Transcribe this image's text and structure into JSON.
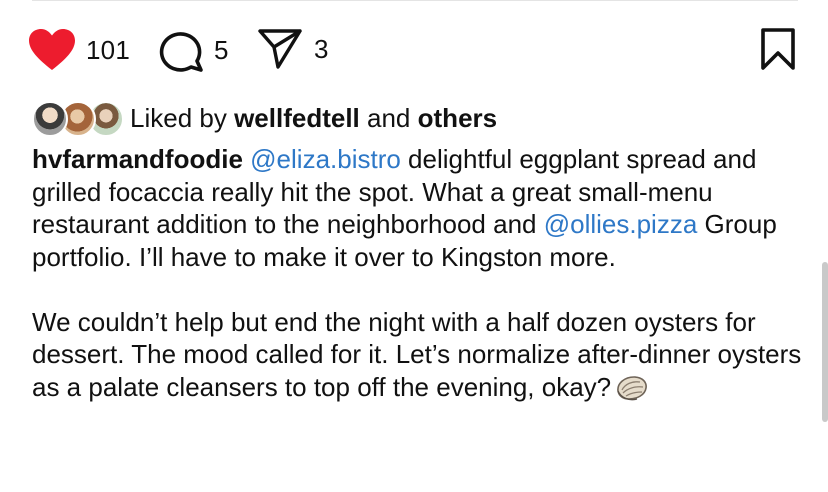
{
  "post": {
    "actions": {
      "likes_count": "101",
      "comments_count": "5",
      "shares_count": "3"
    },
    "liked_by": {
      "prefix": "Liked by",
      "user": "wellfedtell",
      "conjunction": "and",
      "others": "others"
    },
    "caption": {
      "author": "hvfarmandfoodie",
      "mention_1": "@eliza.bistro",
      "text_1": " delightful eggplant spread and grilled focaccia really hit the spot. What a great small-menu restaurant addition to the neighborhood and ",
      "mention_2": "@ollies.pizza",
      "text_2": " Group portfolio. I’ll have to make it over to Kingston more.",
      "paragraph_2": "We couldn’t help but end the night with a half dozen oysters for dessert. The mood called for it. Let’s normalize after-dinner oysters as a palate cleansers to top off the evening, okay?"
    },
    "icons": {
      "like": "heart-filled-icon",
      "comment": "comment-bubble-icon",
      "share": "paper-plane-icon",
      "save": "bookmark-icon",
      "emoji": "oyster-emoji-icon"
    },
    "colors": {
      "like": "#ed1c2e",
      "mention": "#2e78c7",
      "text": "#111111"
    }
  }
}
